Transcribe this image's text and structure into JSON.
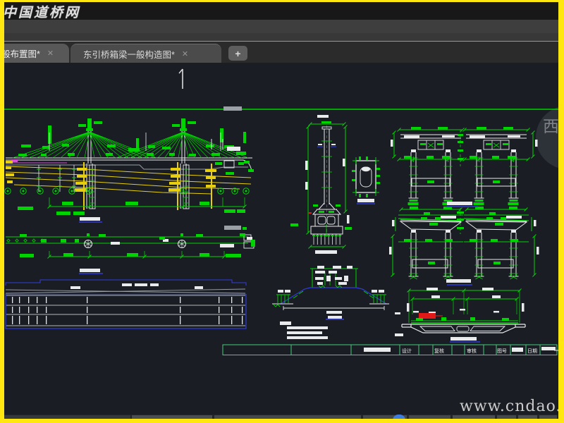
{
  "watermarks": {
    "top_left": "中国道桥网",
    "bottom_right": "www.cndao.com",
    "right_edge": "西"
  },
  "tab_bar": {
    "tabs": [
      {
        "label": "般布置图*"
      },
      {
        "label": "东引桥箱梁一般构造图*"
      }
    ],
    "close_glyph": "✕",
    "new_tab_glyph": "+"
  },
  "title_block": {
    "labels": [
      "设计",
      "复核",
      "审核",
      "图号",
      "日期"
    ]
  },
  "colors": {
    "frame_yellow": "#ffe70f",
    "cad_green": "#00d400",
    "cad_yellow": "#e7cf10",
    "cad_white": "#e9eaec",
    "cad_blue": "#2f3cdd",
    "cad_red": "#e11818",
    "cad_magenta": "#d24fd2",
    "cad_gray": "#9aa0a6",
    "title_block_green": "#43c978"
  }
}
